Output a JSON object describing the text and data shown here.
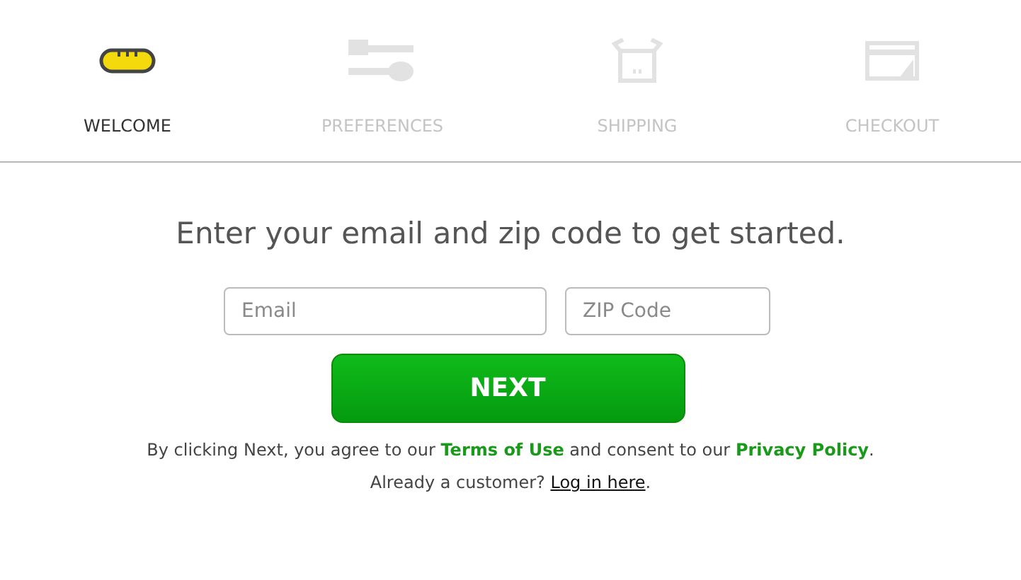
{
  "steps": [
    {
      "kind": "bread",
      "label": "WELCOME",
      "selected": true
    },
    {
      "kind": "utensils",
      "label": "PREFERENCES",
      "selected": false
    },
    {
      "kind": "box",
      "label": "SHIPPING",
      "selected": false
    },
    {
      "kind": "card",
      "label": "CHECKOUT",
      "selected": false
    }
  ],
  "heading": "Enter your email and zip code to get started.",
  "fields": [
    {
      "placeholder": "Email"
    },
    {
      "placeholder": "ZIP Code"
    }
  ],
  "button": "NEXT",
  "legal": {
    "before": "By clicking Next, you agree to our ",
    "link1": "Terms of Use",
    "middle": " and consent to our ",
    "link2": "Privacy Policy",
    "after": "."
  },
  "login": {
    "before": "Already a customer? ",
    "link": "Log in here",
    "after": "."
  }
}
